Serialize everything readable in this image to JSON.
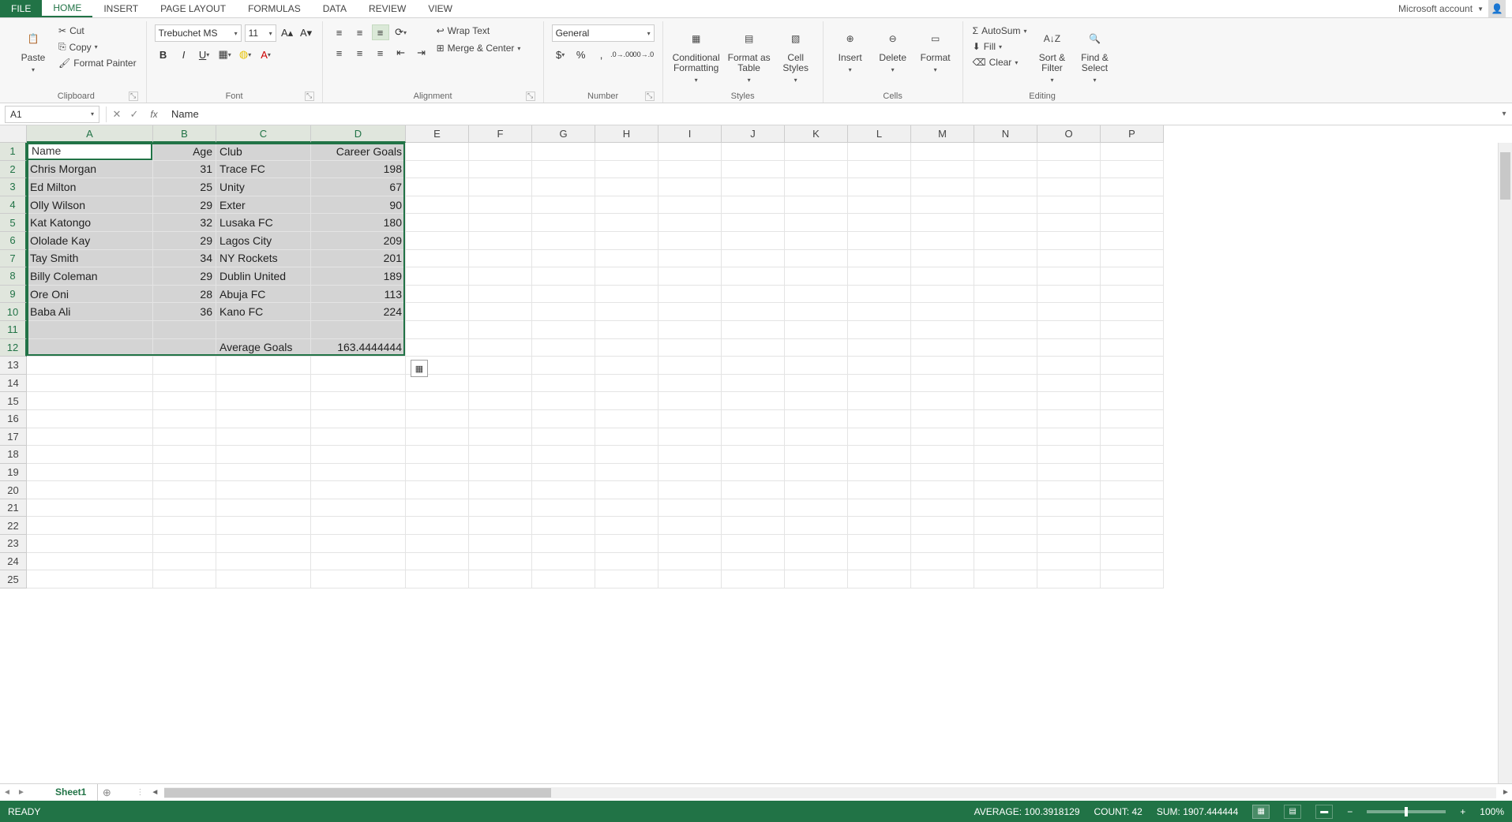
{
  "tabs": {
    "file": "FILE",
    "home": "HOME",
    "insert": "INSERT",
    "pagelayout": "PAGE LAYOUT",
    "formulas": "FORMULAS",
    "data": "DATA",
    "review": "REVIEW",
    "view": "VIEW",
    "account": "Microsoft account"
  },
  "ribbon": {
    "clipboard": {
      "paste": "Paste",
      "cut": "Cut",
      "copy": "Copy",
      "fmtpainter": "Format Painter",
      "label": "Clipboard"
    },
    "font": {
      "name": "Trebuchet MS",
      "size": "11",
      "label": "Font"
    },
    "alignment": {
      "wrap": "Wrap Text",
      "merge": "Merge & Center",
      "label": "Alignment"
    },
    "number": {
      "format": "General",
      "label": "Number"
    },
    "styles": {
      "cond": "Conditional\nFormatting",
      "fat": "Format as\nTable",
      "cell": "Cell\nStyles",
      "label": "Styles"
    },
    "cells": {
      "insert": "Insert",
      "delete": "Delete",
      "format": "Format",
      "label": "Cells"
    },
    "editing": {
      "autosum": "AutoSum",
      "fill": "Fill",
      "clear": "Clear",
      "sort": "Sort &\nFilter",
      "find": "Find &\nSelect",
      "label": "Editing"
    }
  },
  "formulabar": {
    "namebox": "A1",
    "value": "Name"
  },
  "sheet": {
    "colWidths": {
      "A": 160,
      "B": 80,
      "C": 120,
      "D": 120,
      "rest": 80
    },
    "columns": [
      "A",
      "B",
      "C",
      "D",
      "E",
      "F",
      "G",
      "H",
      "I",
      "J",
      "K",
      "L",
      "M",
      "N",
      "O",
      "P"
    ],
    "rows": 25,
    "selectedCols": 4,
    "selectedRows": 12,
    "data": [
      [
        "Name",
        "Age",
        "Club",
        "Career Goals"
      ],
      [
        "Chris Morgan",
        "31",
        "Trace FC",
        "198"
      ],
      [
        "Ed Milton",
        "25",
        "Unity",
        "67"
      ],
      [
        "Olly Wilson",
        "29",
        "Exter",
        "90"
      ],
      [
        "Kat Katongo",
        "32",
        "Lusaka FC",
        "180"
      ],
      [
        "Ololade Kay",
        "29",
        "Lagos City",
        "209"
      ],
      [
        "Tay Smith",
        "34",
        "NY Rockets",
        "201"
      ],
      [
        "Billy Coleman",
        "29",
        "Dublin United",
        "189"
      ],
      [
        "Ore Oni",
        "28",
        "Abuja FC",
        "113"
      ],
      [
        "Baba Ali",
        "36",
        "Kano FC",
        "224"
      ],
      [
        "",
        "",
        "",
        ""
      ],
      [
        "",
        "",
        "Average Goals",
        "163.4444444"
      ]
    ],
    "numericCols": [
      1,
      3
    ]
  },
  "sheettabs": {
    "name": "Sheet1"
  },
  "status": {
    "ready": "READY",
    "avg": "AVERAGE: 100.3918129",
    "count": "COUNT: 42",
    "sum": "SUM: 1907.444444",
    "zoom": "100%"
  }
}
